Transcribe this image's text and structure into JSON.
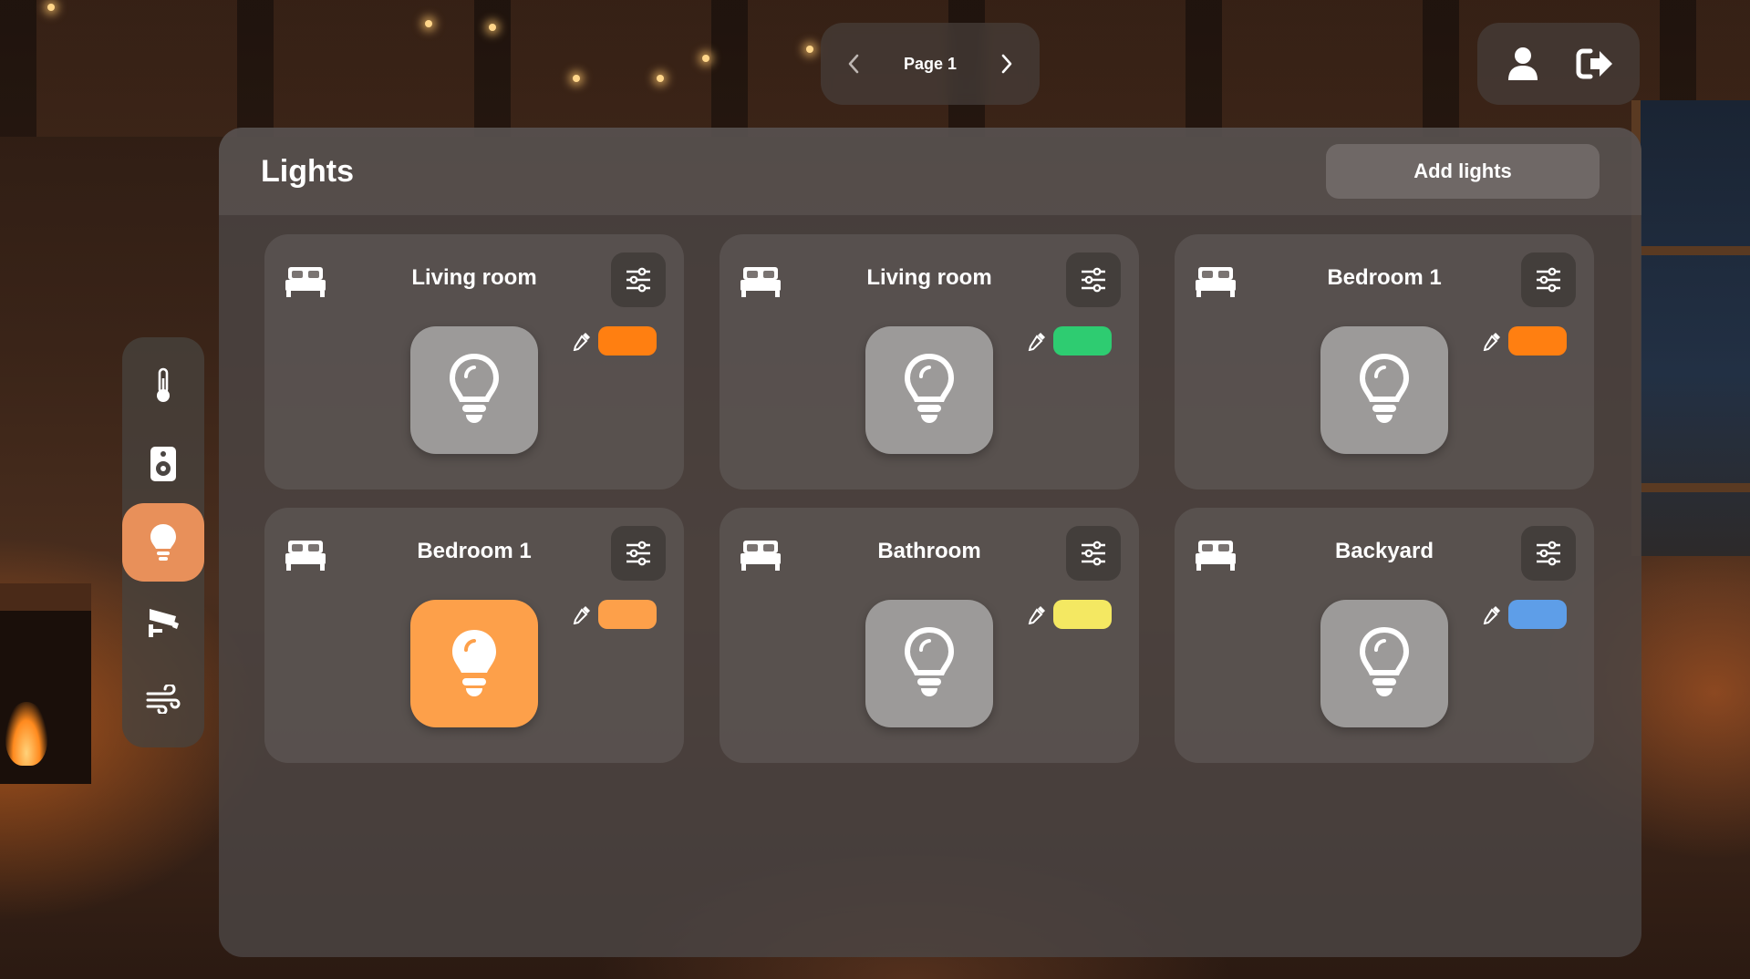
{
  "pager": {
    "prev_icon": "chevron-left-icon",
    "label": "Page 1",
    "next_icon": "chevron-right-icon"
  },
  "account": {
    "user_icon": "user-icon",
    "logout_icon": "logout-icon"
  },
  "sidenav": {
    "items": [
      {
        "icon": "thermometer-icon",
        "active": false
      },
      {
        "icon": "speaker-icon",
        "active": false
      },
      {
        "icon": "lightbulb-icon",
        "active": true
      },
      {
        "icon": "security-camera-icon",
        "active": false
      },
      {
        "icon": "wind-icon",
        "active": false
      }
    ],
    "active_color": "#e8905a"
  },
  "panel": {
    "title": "Lights",
    "add_button": "Add lights"
  },
  "lights": [
    {
      "room": "Living room",
      "on": false,
      "color": "#ff7f11"
    },
    {
      "room": "Living room",
      "on": false,
      "color": "#2ecc71"
    },
    {
      "room": "Bedroom 1",
      "on": false,
      "color": "#ff7f11"
    },
    {
      "room": "Bedroom 1",
      "on": true,
      "color": "#fda04a"
    },
    {
      "room": "Bathroom",
      "on": false,
      "color": "#f4e862"
    },
    {
      "room": "Backyard",
      "on": false,
      "color": "#5e9ee8"
    }
  ],
  "colors": {
    "bulb_off": "#9c9a99",
    "bulb_on": "#fda04a"
  }
}
